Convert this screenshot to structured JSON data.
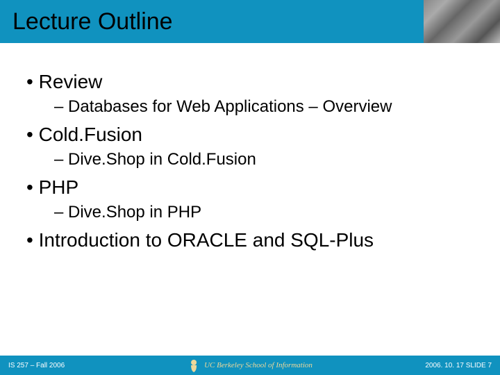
{
  "header": {
    "title": "Lecture Outline"
  },
  "outline": {
    "item1": "Review",
    "item1_sub1": "Databases for Web Applications – Overview",
    "item2": "Cold.Fusion",
    "item2_sub1": "Dive.Shop in Cold.Fusion",
    "item3": "PHP",
    "item3_sub1": "Dive.Shop in PHP",
    "item4": "Introduction to ORACLE and SQL-Plus"
  },
  "footer": {
    "left": "IS 257 – Fall 2006",
    "school": "UC Berkeley School of Information",
    "right": "2006. 10. 17 SLIDE 7"
  }
}
